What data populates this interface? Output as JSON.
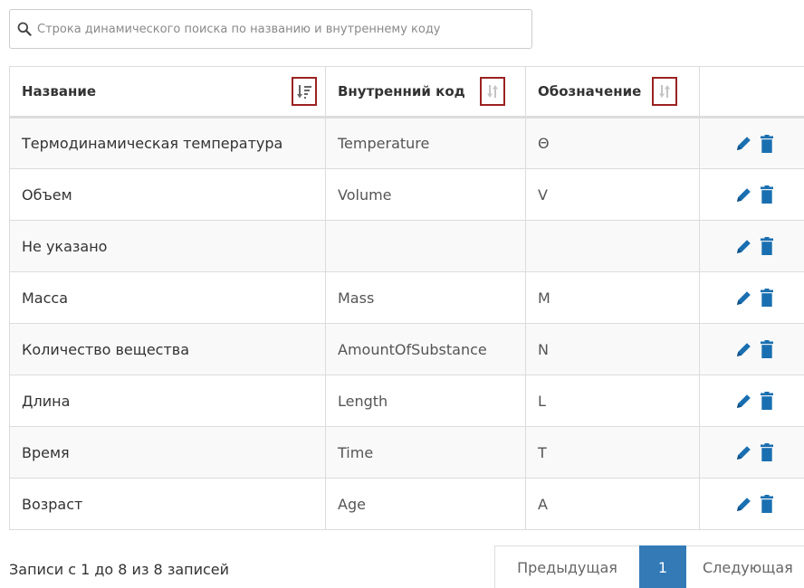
{
  "search": {
    "placeholder": "Строка динамического поиска по названию и внутреннему коду",
    "value": ""
  },
  "table": {
    "headers": {
      "name": "Название",
      "code": "Внутренний код",
      "symbol": "Обозначение"
    },
    "sort_state": {
      "name": "sorted-ascending",
      "code": "unsorted",
      "symbol": "unsorted"
    },
    "rows": [
      {
        "name": "Термодинамическая температура",
        "code": "Temperature",
        "symbol": "Θ"
      },
      {
        "name": "Объем",
        "code": "Volume",
        "symbol": "V"
      },
      {
        "name": "Не указано",
        "code": "",
        "symbol": ""
      },
      {
        "name": "Масса",
        "code": "Mass",
        "symbol": "M"
      },
      {
        "name": "Количество вещества",
        "code": "AmountOfSubstance",
        "symbol": "N"
      },
      {
        "name": "Длина",
        "code": "Length",
        "symbol": "L"
      },
      {
        "name": "Время",
        "code": "Time",
        "symbol": "T"
      },
      {
        "name": "Возраст",
        "code": "Age",
        "symbol": "A"
      }
    ],
    "row_icons": [
      "pencil-icon",
      "trash-icon"
    ]
  },
  "footer": {
    "info": "Записи с 1 до 8 из 8 записей",
    "pagination": {
      "prev_label": "Предыдущая",
      "current_page": "1",
      "next_label": "Следующая"
    }
  },
  "colors": {
    "accent": "#337ab7",
    "sort_highlight": "#9b2222",
    "action_icon": "#1a6fb0"
  }
}
